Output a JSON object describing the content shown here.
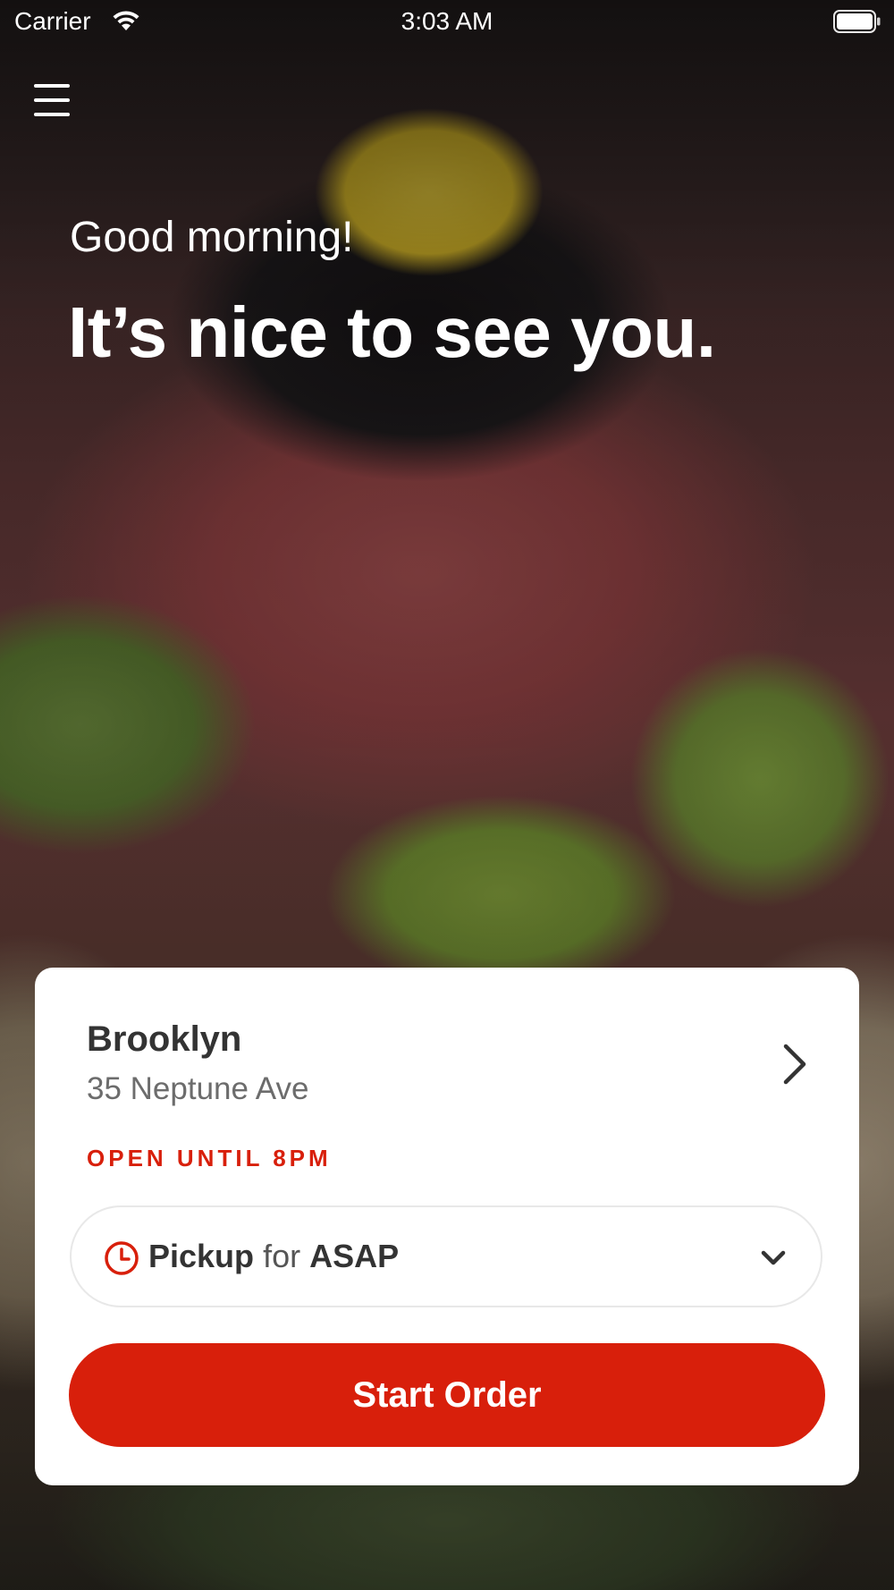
{
  "status_bar": {
    "carrier": "Carrier",
    "time": "3:03 AM",
    "wifi_icon": "wifi-icon",
    "battery_icon": "battery-icon"
  },
  "header": {
    "menu_icon": "hamburger-menu-icon",
    "greeting": "Good morning!",
    "headline": "It’s nice to see you."
  },
  "location_card": {
    "name": "Brooklyn",
    "address": "35 Neptune Ave",
    "hours": "OPEN UNTIL 8PM",
    "chevron_icon": "chevron-right-icon",
    "pickup": {
      "clock_icon": "clock-icon",
      "mode": "Pickup",
      "connector": "for",
      "time": "ASAP",
      "dropdown_icon": "chevron-down-icon"
    },
    "start_order_label": "Start Order"
  },
  "colors": {
    "accent": "#d81f0b",
    "text_dark": "#333333",
    "text_muted": "#6c6c6c",
    "card_bg": "#ffffff"
  }
}
